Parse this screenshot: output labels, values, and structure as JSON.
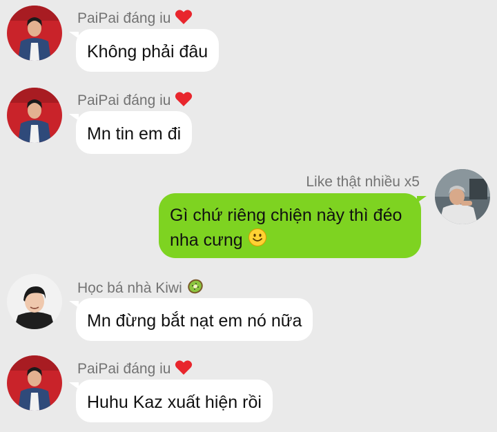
{
  "messages": [
    {
      "sender": "PaiPai đáng iu",
      "badge": "heart-icon",
      "text": "Không phải đâu"
    },
    {
      "sender": "PaiPai đáng iu",
      "badge": "heart-icon",
      "text": "Mn tin em đi"
    },
    {
      "sender": "Like thật nhiều x5",
      "text_line1": "Gì chứ riêng chiện này thì đéo",
      "text_line2": "nha cưng",
      "emoji": "smile-emoji"
    },
    {
      "sender": "Học bá nhà Kiwi",
      "badge": "kiwi-icon",
      "text": "Mn đừng bắt nạt em nó nữa"
    },
    {
      "sender": "PaiPai đáng iu",
      "badge": "heart-icon",
      "text": "Huhu Kaz xuất hiện rồi"
    }
  ],
  "colors": {
    "background": "#eaeaea",
    "incoming_bubble": "#ffffff",
    "outgoing_bubble": "#7ed321",
    "sender_name": "#737373",
    "heart": "#e8262d"
  }
}
